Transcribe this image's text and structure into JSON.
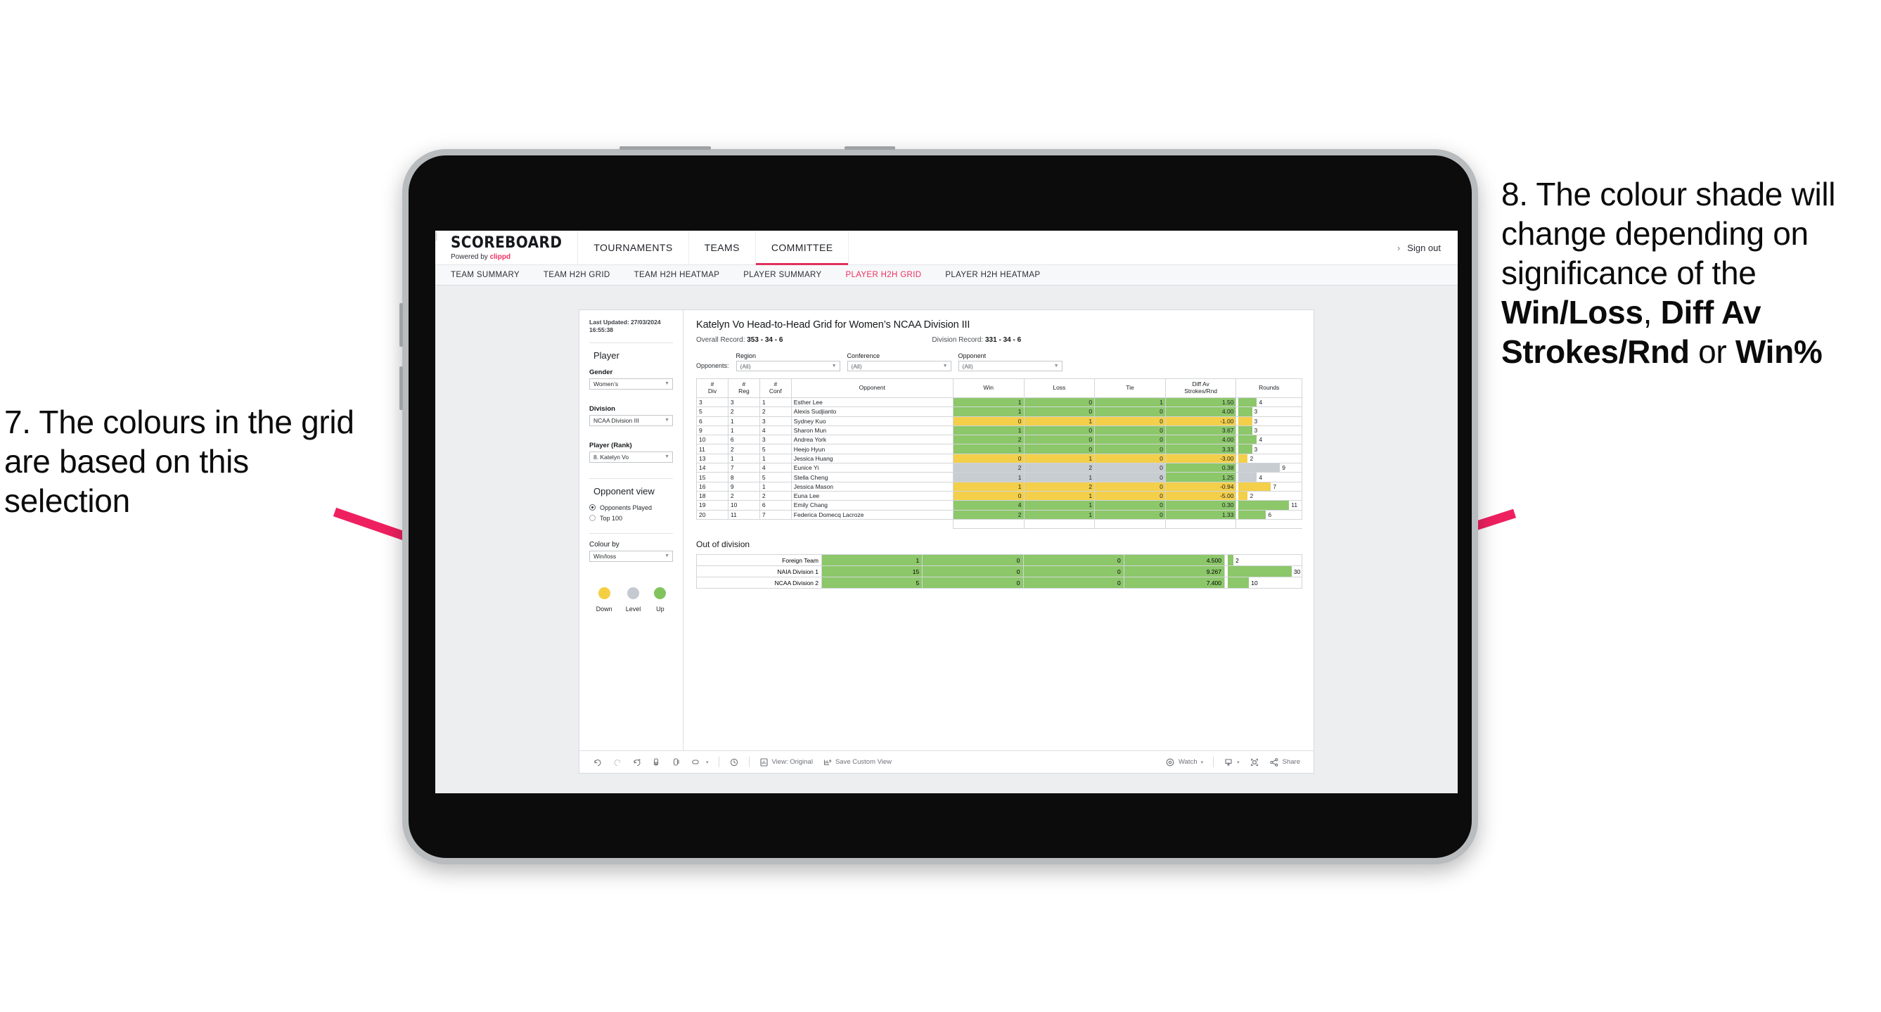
{
  "annotations": {
    "left": {
      "number": "7.",
      "text": "7. The colours in the grid are based on this selection"
    },
    "right": {
      "line1": "8. The colour shade will change depending on significance of the ",
      "bold1": "Win/Loss",
      "mid1": ", ",
      "bold2": "Diff Av Strokes/Rnd",
      "mid2": " or ",
      "bold3": "Win%"
    },
    "arrow_color": "#ef2060"
  },
  "app": {
    "brand": {
      "title": "SCOREBOARD",
      "sub_prefix": "Powered by ",
      "sub_brand": "clippd"
    },
    "top_nav": [
      {
        "label": "TOURNAMENTS",
        "active": false
      },
      {
        "label": "TEAMS",
        "active": false
      },
      {
        "label": "COMMITTEE",
        "active": true
      }
    ],
    "account": {
      "chevron": "›",
      "divider": "|",
      "sign_out": "Sign out"
    },
    "sub_nav": [
      {
        "label": "TEAM SUMMARY",
        "active": false
      },
      {
        "label": "TEAM H2H GRID",
        "active": false
      },
      {
        "label": "TEAM H2H HEATMAP",
        "active": false
      },
      {
        "label": "PLAYER SUMMARY",
        "active": false
      },
      {
        "label": "PLAYER H2H GRID",
        "active": true
      },
      {
        "label": "PLAYER H2H HEATMAP",
        "active": false
      }
    ]
  },
  "panel": {
    "last_updated": "Last Updated: 27/03/2024 16:55:38",
    "player_heading": "Player",
    "gender": {
      "label": "Gender",
      "value": "Women’s"
    },
    "division": {
      "label": "Division",
      "value": "NCAA Division III"
    },
    "player_rank": {
      "label": "Player (Rank)",
      "value": "8. Katelyn Vo"
    },
    "opponent_view": {
      "heading": "Opponent view",
      "options": [
        {
          "label": "Opponents Played",
          "selected": true
        },
        {
          "label": "Top 100",
          "selected": false
        }
      ]
    },
    "colour_by": {
      "label": "Colour by",
      "value": "Win/loss"
    },
    "legend": [
      {
        "label": "Down",
        "color": "#f4cf41"
      },
      {
        "label": "Level",
        "color": "#c5cad0"
      },
      {
        "label": "Up",
        "color": "#82c35d"
      }
    ]
  },
  "viz": {
    "title": "Katelyn Vo Head-to-Head Grid for Women’s NCAA Division III",
    "overall_record_label": "Overall Record: ",
    "overall_record_value": "353 - 34 - 6",
    "division_record_label": "Division Record: ",
    "division_record_value": "331 - 34 - 6",
    "opponents_label": "Opponents:",
    "filters": [
      {
        "label": "Region",
        "value": "(All)"
      },
      {
        "label": "Conference",
        "value": "(All)"
      },
      {
        "label": "Opponent",
        "value": "(All)"
      }
    ],
    "columns": [
      {
        "line1": "#",
        "line2": "Div"
      },
      {
        "line1": "#",
        "line2": "Reg"
      },
      {
        "line1": "#",
        "line2": "Conf"
      },
      {
        "line1": "Opponent",
        "line2": ""
      },
      {
        "line1": "Win",
        "line2": ""
      },
      {
        "line1": "Loss",
        "line2": ""
      },
      {
        "line1": "Tie",
        "line2": ""
      },
      {
        "line1": "Diff Av",
        "line2": "Strokes/Rnd"
      },
      {
        "line1": "Rounds",
        "line2": ""
      }
    ],
    "rows": [
      {
        "div": "3",
        "reg": "3",
        "conf": "1",
        "opponent": "Esther Lee",
        "win": "1",
        "loss": "0",
        "tie": "1",
        "diff": "1.50",
        "rounds": "4",
        "rounds_pct": 30,
        "color": "#8cc76a"
      },
      {
        "div": "5",
        "reg": "2",
        "conf": "2",
        "opponent": "Alexis Sudjianto",
        "win": "1",
        "loss": "0",
        "tie": "0",
        "diff": "4.00",
        "rounds": "3",
        "rounds_pct": 22,
        "color": "#8cc76a"
      },
      {
        "div": "6",
        "reg": "1",
        "conf": "3",
        "opponent": "Sydney Kuo",
        "win": "0",
        "loss": "1",
        "tie": "0",
        "diff": "-1.00",
        "rounds": "3",
        "rounds_pct": 22,
        "color": "#f3cf4a"
      },
      {
        "div": "9",
        "reg": "1",
        "conf": "4",
        "opponent": "Sharon Mun",
        "win": "1",
        "loss": "0",
        "tie": "0",
        "diff": "3.67",
        "rounds": "3",
        "rounds_pct": 22,
        "color": "#8cc76a"
      },
      {
        "div": "10",
        "reg": "6",
        "conf": "3",
        "opponent": "Andrea York",
        "win": "2",
        "loss": "0",
        "tie": "0",
        "diff": "4.00",
        "rounds": "4",
        "rounds_pct": 30,
        "color": "#8cc76a"
      },
      {
        "div": "11",
        "reg": "2",
        "conf": "5",
        "opponent": "Heejo Hyun",
        "win": "1",
        "loss": "0",
        "tie": "0",
        "diff": "3.33",
        "rounds": "3",
        "rounds_pct": 22,
        "color": "#8cc76a"
      },
      {
        "div": "13",
        "reg": "1",
        "conf": "1",
        "opponent": "Jessica Huang",
        "win": "0",
        "loss": "1",
        "tie": "0",
        "diff": "-3.00",
        "rounds": "2",
        "rounds_pct": 15,
        "color": "#f3cf4a"
      },
      {
        "div": "14",
        "reg": "7",
        "conf": "4",
        "opponent": "Eunice Yi",
        "win": "2",
        "loss": "2",
        "tie": "0",
        "diff": "0.38",
        "rounds": "9",
        "rounds_pct": 68,
        "color": "#c8cdd2",
        "diff_color": "#8cc76a"
      },
      {
        "div": "15",
        "reg": "8",
        "conf": "5",
        "opponent": "Stella Cheng",
        "win": "1",
        "loss": "1",
        "tie": "0",
        "diff": "1.25",
        "rounds": "4",
        "rounds_pct": 30,
        "color": "#c8cdd2",
        "diff_color": "#8cc76a"
      },
      {
        "div": "16",
        "reg": "9",
        "conf": "1",
        "opponent": "Jessica Mason",
        "win": "1",
        "loss": "2",
        "tie": "0",
        "diff": "-0.94",
        "rounds": "7",
        "rounds_pct": 53,
        "color": "#f3cf4a"
      },
      {
        "div": "18",
        "reg": "2",
        "conf": "2",
        "opponent": "Euna Lee",
        "win": "0",
        "loss": "1",
        "tie": "0",
        "diff": "-5.00",
        "rounds": "2",
        "rounds_pct": 15,
        "color": "#f3cf4a"
      },
      {
        "div": "19",
        "reg": "10",
        "conf": "6",
        "opponent": "Emily Chang",
        "win": "4",
        "loss": "1",
        "tie": "0",
        "diff": "0.30",
        "rounds": "11",
        "rounds_pct": 83,
        "color": "#8cc76a"
      },
      {
        "div": "20",
        "reg": "11",
        "conf": "7",
        "opponent": "Federica Domecq Lacroze",
        "win": "2",
        "loss": "1",
        "tie": "0",
        "diff": "1.33",
        "rounds": "6",
        "rounds_pct": 45,
        "color": "#8cc76a"
      }
    ],
    "out_of_division": {
      "title": "Out of division",
      "rows": [
        {
          "name": "Foreign Team",
          "win": "1",
          "loss": "0",
          "tie": "0",
          "diff": "4.500",
          "rounds": "2",
          "rounds_pct": 8,
          "color": "#8cc76a"
        },
        {
          "name": "NAIA Division 1",
          "win": "15",
          "loss": "0",
          "tie": "0",
          "diff": "9.267",
          "rounds": "30",
          "rounds_pct": 90,
          "color": "#8cc76a"
        },
        {
          "name": "NCAA Division 2",
          "win": "5",
          "loss": "0",
          "tie": "0",
          "diff": "7.400",
          "rounds": "10",
          "rounds_pct": 30,
          "color": "#8cc76a"
        }
      ]
    }
  },
  "toolbar": {
    "view_original": "View: Original",
    "save_custom_view": "Save Custom View",
    "watch": "Watch",
    "share": "Share",
    "caret": "▾"
  }
}
